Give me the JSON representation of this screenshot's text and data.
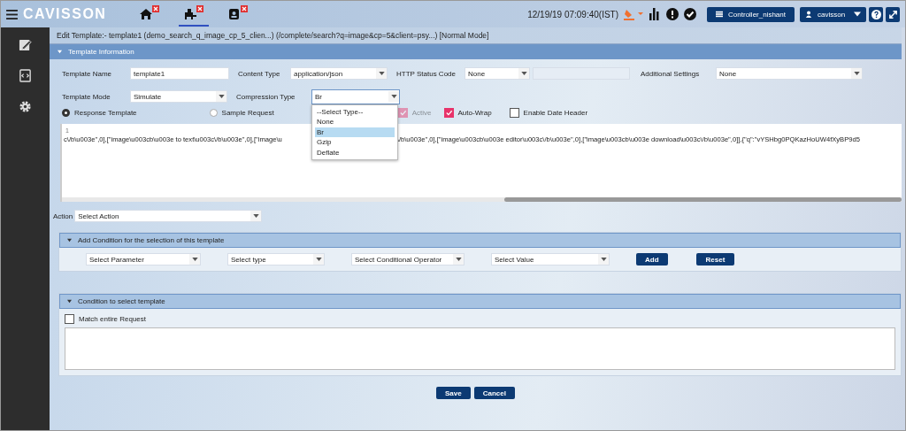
{
  "topbar": {
    "logo": "CAVISSON",
    "tabs": [
      {
        "kind": "home",
        "selected": false
      },
      {
        "kind": "network",
        "selected": true
      },
      {
        "kind": "contact",
        "selected": false
      }
    ],
    "datetime": "12/19/19 07:09:40(IST)",
    "controller": "Controller_nishant",
    "user": "cavisson"
  },
  "page_title": "Edit Template:- template1 (demo_search_q_image_cp_5_clien...) (/complete/search?q=image&cp=5&client=psy...) [Normal Mode]",
  "template_info": {
    "title": "Template Information",
    "expanded": true,
    "rows": [
      [
        {
          "label": "Template Name",
          "kind": "text",
          "value": "template1"
        },
        {
          "label": "Content Type",
          "kind": "select",
          "value": "application/json"
        },
        {
          "label": "HTTP Status Code",
          "kind": "select",
          "value": "None"
        },
        {
          "kind": "blank",
          "disabled": true
        },
        {
          "label": "Additional Settings",
          "kind": "select",
          "value": "None"
        }
      ],
      [
        {
          "label": "Template Mode",
          "kind": "select",
          "value": "Simulate"
        },
        {
          "label": "Compression Type",
          "kind": "select",
          "value": "Br",
          "focused": true
        }
      ]
    ],
    "radios": [
      {
        "label": "Response Template",
        "selected": true
      },
      {
        "label": "Sample Request",
        "selected": false
      }
    ],
    "checkboxes": [
      {
        "label": "Active",
        "checked": true,
        "disabled": true
      },
      {
        "label": "Auto-Wrap",
        "checked": true,
        "disabled": false
      },
      {
        "label": "Enable Date Header",
        "checked": false,
        "disabled": false
      }
    ],
    "dropdown_options": [
      {
        "label": "--Select Type--",
        "selected": false
      },
      {
        "label": "None",
        "selected": false
      },
      {
        "label": "Br",
        "selected": true
      },
      {
        "label": "Gzip",
        "selected": false
      },
      {
        "label": "Deflate",
        "selected": false
      }
    ],
    "editor": {
      "line_number": "1",
      "segments": [
        "c\\/b\\u003e\",0],[\"image\\u003cb\\u003e to text\\u003c\\/b\\u003e\",0],[\"image\\u",
        "\\/b\\u003e\",0],[\"image\\u003cb\\u003e editor\\u003c\\/b\\u003e\",0],[\"image\\u003cb\\u003e download\\u003c\\/b\\u003e\",0]],{\"q\":\"vYSHbg0PQKazHoUW4fXyBP9d5"
      ]
    },
    "action": {
      "label": "Action",
      "value": "Select Action"
    }
  },
  "add_condition": {
    "title": "Add Condition for the selection of this template",
    "expanded": true,
    "selects": [
      "Select Parameter",
      "Select type",
      "Select Conditional Operator",
      "Select Value"
    ],
    "buttons": [
      "Add",
      "Reset"
    ]
  },
  "condition_select": {
    "title": "Condition to select template",
    "expanded": true,
    "match": {
      "label": "Match entire Request",
      "checked": false
    }
  },
  "footer_buttons": [
    "Save",
    "Cancel"
  ]
}
